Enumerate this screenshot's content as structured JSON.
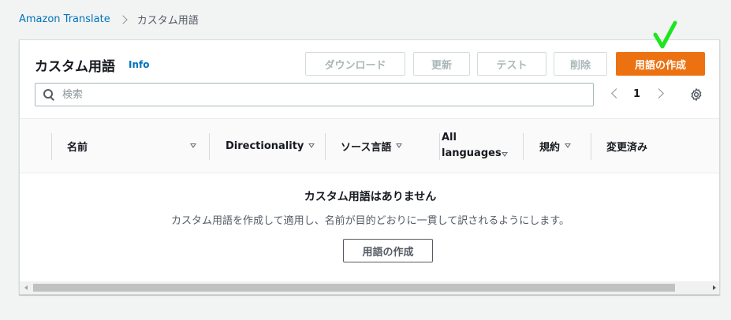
{
  "breadcrumb": {
    "root": "Amazon Translate",
    "current": "カスタム用語"
  },
  "panel": {
    "title": "カスタム用語",
    "info_link": "Info",
    "buttons": {
      "download": "ダウンロード",
      "update": "更新",
      "test": "テスト",
      "delete": "削除",
      "create": "用語の作成"
    }
  },
  "search": {
    "placeholder": "検索",
    "value": ""
  },
  "pagination": {
    "current_page": "1"
  },
  "table": {
    "columns": [
      "名前",
      "Directionality",
      "ソース言語",
      "All languages",
      "規約",
      "変更済み"
    ]
  },
  "empty_state": {
    "title": "カスタム用語はありません",
    "description": "カスタム用語を作成して適用し、名前が目的どおりに一貫して訳されるようにします。",
    "button": "用語の作成"
  },
  "colors": {
    "primary_button": "#ec7211",
    "link": "#0073bb",
    "annotation_check": "#1ee51e"
  },
  "icons": [
    "chevron-right-icon",
    "search-icon",
    "chevron-left-icon",
    "gear-icon",
    "sort-down-icon",
    "checkmark-annotation-icon"
  ]
}
